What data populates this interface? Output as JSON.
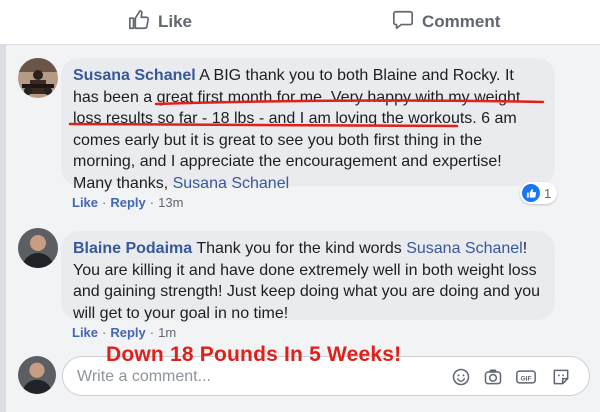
{
  "top_actions": {
    "like_label": "Like",
    "comment_label": "Comment"
  },
  "comments": [
    {
      "author": "Susana Schanel",
      "text_a": "A BIG thank you to both Blaine and Rocky. It has been a ",
      "text_b": "great first month for me. Very happy with my weight loss results so far - 18 lbs - and I am loving the workouts.",
      "text_c": " 6 am comes early but it is great to see you both first thing in the morning, and I appreciate the encouragement and expertise! Many thanks, ",
      "mention": "Susana Schanel",
      "like_action": "Like",
      "reply_action": "Reply",
      "time": "13m",
      "reaction_count": "1"
    },
    {
      "author": "Blaine Podaima",
      "text_a": "Thank you for the kind words ",
      "mention": "Susana Schanel",
      "text_b": "! You are killing it and have done extremely well in both weight loss and gaining strength! Just keep doing what you are doing and you will get to your goal in no time!",
      "like_action": "Like",
      "reply_action": "Reply",
      "time": "1m"
    }
  ],
  "overlay_caption": "Down 18 Pounds In 5 Weeks!",
  "comment_input": {
    "placeholder": "Write a comment..."
  },
  "input_icons": [
    "emoji-icon",
    "camera-icon",
    "gif-icon",
    "sticker-icon"
  ],
  "colors": {
    "accent": "#385898",
    "caption": "#e0201b",
    "underline": "#e0201b"
  }
}
